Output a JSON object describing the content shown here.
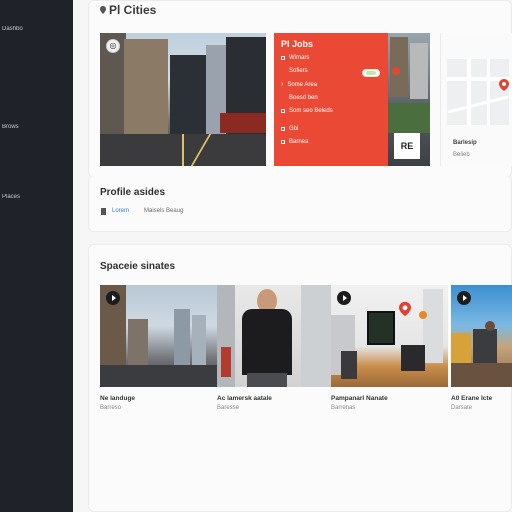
{
  "sidebar": {
    "items": [
      {
        "label": "Dashbo"
      },
      {
        "label": "Brows"
      },
      {
        "label": "Places"
      }
    ]
  },
  "hero": {
    "title": "Pl Cities"
  },
  "redpanel": {
    "title": "Pl Jobs",
    "items": [
      {
        "label": "Wimars"
      },
      {
        "label": "Sofiers"
      },
      {
        "label": "Some Area"
      },
      {
        "label": "Boesd ben"
      },
      {
        "label": "Som seo Beleds"
      },
      {
        "label": "Gbi"
      },
      {
        "label": "Barnea"
      }
    ],
    "qr_label": "RE"
  },
  "map": {
    "label": "Barlesip",
    "sub": "Belieb"
  },
  "profile": {
    "title": "Profile asides",
    "tabs": [
      {
        "label": "Lorem",
        "color": "#3b78d8"
      },
      {
        "label": "Maisels Beaug",
        "color": "#6a6a6a"
      }
    ]
  },
  "spaces": {
    "title": "Spaceie sinates",
    "cards": [
      {
        "title": "Ne landuge",
        "sub": "Barreso"
      },
      {
        "title": "Ac lamersk aatale",
        "sub": "Baresse"
      },
      {
        "title": "Pampanarl Nanate",
        "sub": "Barrenas"
      },
      {
        "title": "A0 Erane Icte",
        "sub": "Darsate"
      }
    ]
  },
  "colors": {
    "sidebar_bg": "#1f2228",
    "accent_red": "#ea4a35",
    "link_blue": "#3b78d8"
  }
}
